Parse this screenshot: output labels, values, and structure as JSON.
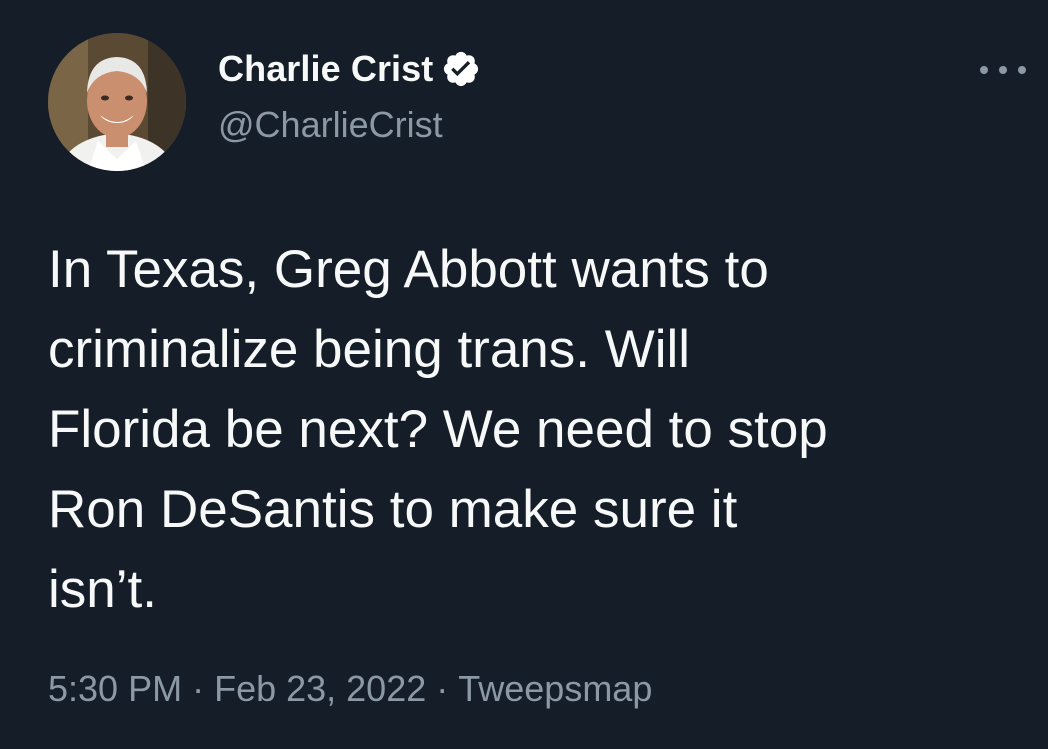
{
  "author": {
    "display_name": "Charlie Crist",
    "handle": "@CharlieCrist",
    "verified": true,
    "avatar_icon": "profile-photo"
  },
  "tweet": {
    "text": "In Texas, Greg Abbott wants to\ncriminalize being trans. Will\nFlorida be next? We need to stop\nRon DeSantis to make sure it\nisn’t.",
    "time": "5:30 PM",
    "date": "Feb 23, 2022",
    "separator": "·",
    "source": "Tweepsmap"
  },
  "icons": {
    "verified": "verified-badge-icon",
    "more": "more-options-icon"
  },
  "colors": {
    "background": "#151d28",
    "primary_text": "#f7f9f9",
    "secondary_text": "#8b98a5",
    "verified_badge": "#ffffff"
  }
}
